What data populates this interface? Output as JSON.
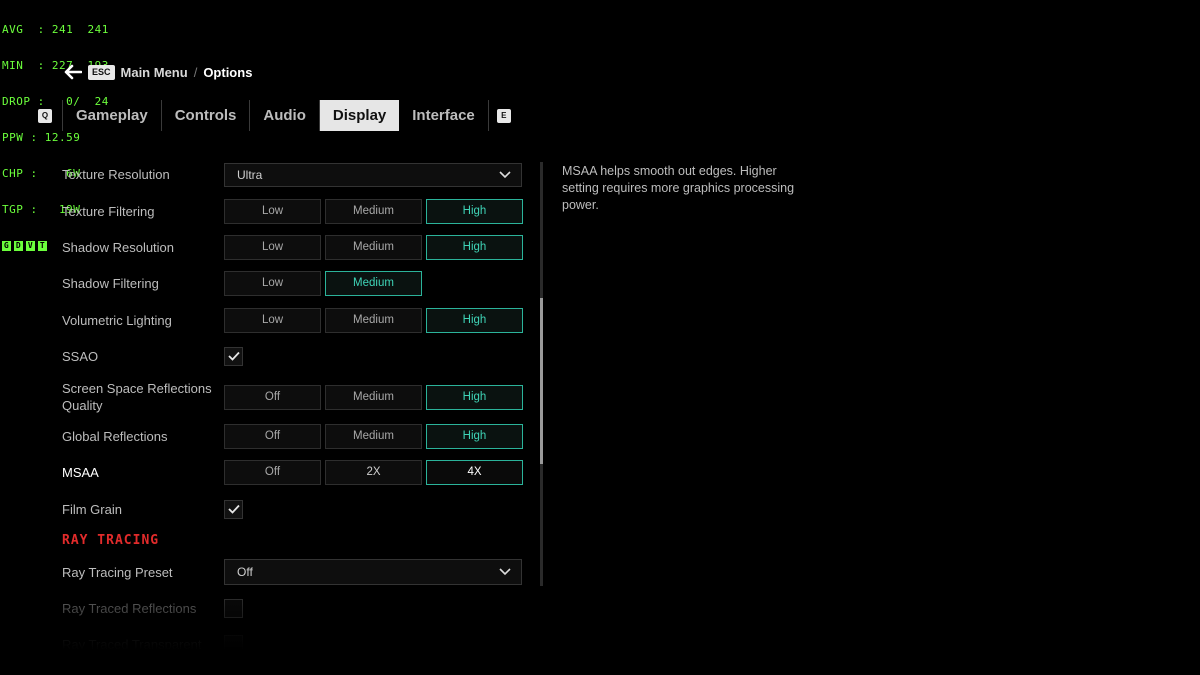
{
  "perf_overlay": {
    "lines": [
      "AVG  : 241  241",
      "MIN  : 227  193",
      "DROP :   0/  24",
      "PPW : 12.59",
      "CHP :    6W",
      "TGP :   19W"
    ],
    "keys": [
      "G",
      "D",
      "V",
      "T"
    ]
  },
  "breadcrumb": {
    "esc_key": "ESC",
    "main": "Main Menu",
    "separator": "/",
    "current": "Options"
  },
  "tabs": {
    "left_key": "Q",
    "right_key": "E",
    "items": [
      {
        "label": "Gameplay",
        "active": false
      },
      {
        "label": "Controls",
        "active": false
      },
      {
        "label": "Audio",
        "active": false
      },
      {
        "label": "Display",
        "active": true
      },
      {
        "label": "Interface",
        "active": false
      }
    ]
  },
  "settings": {
    "texture_resolution": {
      "label": "Texture Resolution",
      "value": "Ultra"
    },
    "texture_filtering": {
      "label": "Texture Filtering",
      "options": [
        "Low",
        "Medium",
        "High"
      ],
      "selected": "High"
    },
    "shadow_resolution": {
      "label": "Shadow Resolution",
      "options": [
        "Low",
        "Medium",
        "High"
      ],
      "selected": "High"
    },
    "shadow_filtering": {
      "label": "Shadow Filtering",
      "options": [
        "Low",
        "Medium"
      ],
      "selected": "Medium"
    },
    "volumetric_lighting": {
      "label": "Volumetric Lighting",
      "options": [
        "Low",
        "Medium",
        "High"
      ],
      "selected": "High"
    },
    "ssao": {
      "label": "SSAO",
      "checked": true
    },
    "ssr_quality": {
      "label": "Screen Space Reflections Quality",
      "options": [
        "Off",
        "Medium",
        "High"
      ],
      "selected": "High"
    },
    "global_reflections": {
      "label": "Global Reflections",
      "options": [
        "Off",
        "Medium",
        "High"
      ],
      "selected": "High"
    },
    "msaa": {
      "label": "MSAA",
      "options": [
        "Off",
        "2X",
        "4X"
      ],
      "selected": "4X",
      "focused": true
    },
    "film_grain": {
      "label": "Film Grain",
      "checked": true
    },
    "ray_tracing_header": "RAY TRACING",
    "ray_tracing_preset": {
      "label": "Ray Tracing Preset",
      "value": "Off"
    },
    "ray_traced_reflections": {
      "label": "Ray Traced Reflections",
      "checked": false
    },
    "ray_traced_transparent": {
      "label": "Ray Traced Transparent",
      "checked": false
    }
  },
  "description": {
    "text": "MSAA helps smooth out edges. Higher setting requires more graphics processing power."
  },
  "colors": {
    "accent": "#2bb39a",
    "accent_text": "#3fd4b7",
    "section_red": "#e22b2b",
    "overlay_green": "#6cff3c"
  }
}
